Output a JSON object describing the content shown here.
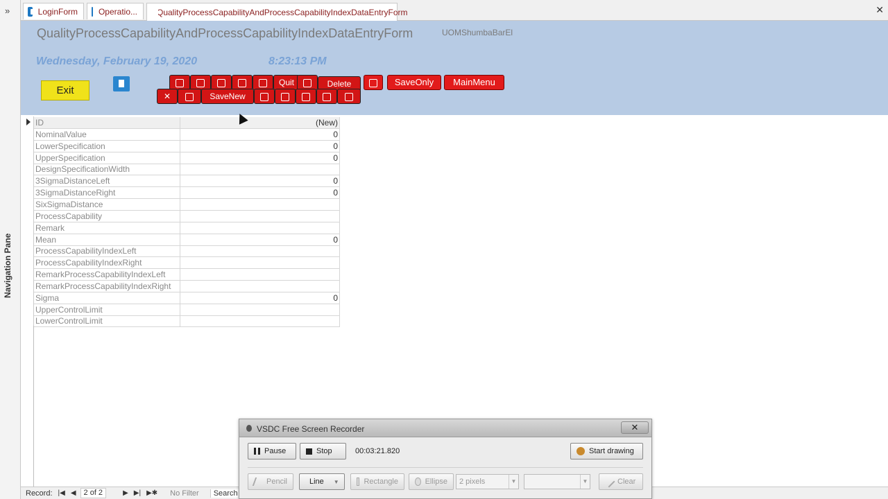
{
  "nav_pane": {
    "label": "Navigation Pane"
  },
  "tabs": [
    {
      "label": "LoginForm"
    },
    {
      "label": "Operatio..."
    },
    {
      "label": "QualityProcessCapabilityAndProcessCapabilityIndexDataEntryForm"
    }
  ],
  "header": {
    "title": "QualityProcessCapabilityAndProcessCapabilityIndexDataEntryForm",
    "user": "UOMShumbaBarEl",
    "date": "Wednesday, February 19, 2020",
    "time": "8:23:13 PM",
    "exit_label": "Exit"
  },
  "toolbar": {
    "quit": "Quit",
    "delete": "Delete",
    "save_new": "SaveNew",
    "save_only": "SaveOnly",
    "main_menu": "MainMenu"
  },
  "fields": [
    {
      "label": "ID",
      "value": "(New)"
    },
    {
      "label": "NominalValue",
      "value": "0"
    },
    {
      "label": "LowerSpecification",
      "value": "0"
    },
    {
      "label": "UpperSpecification",
      "value": "0"
    },
    {
      "label": "DesignSpecificationWidth",
      "value": ""
    },
    {
      "label": "3SigmaDistanceLeft",
      "value": "0"
    },
    {
      "label": "3SigmaDistanceRight",
      "value": "0"
    },
    {
      "label": "SixSigmaDistance",
      "value": ""
    },
    {
      "label": "ProcessCapability",
      "value": ""
    },
    {
      "label": "Remark",
      "value": ""
    },
    {
      "label": "Mean",
      "value": "0"
    },
    {
      "label": "ProcessCapabilityIndexLeft",
      "value": ""
    },
    {
      "label": "ProcessCapabilityIndexRight",
      "value": ""
    },
    {
      "label": "RemarkProcessCapabilityIndexLeft",
      "value": ""
    },
    {
      "label": "RemarkProcessCapabilityIndexRight",
      "value": ""
    },
    {
      "label": "Sigma",
      "value": "0"
    },
    {
      "label": "UpperControlLimit",
      "value": ""
    },
    {
      "label": "LowerControlLimit",
      "value": ""
    }
  ],
  "statusbar": {
    "record_label": "Record:",
    "position": "2 of 2",
    "filter": "No Filter",
    "search": "Search"
  },
  "recorder": {
    "title": "VSDC Free Screen Recorder",
    "close": "✕",
    "pause": "Pause",
    "stop": "Stop",
    "timer": "00:03:21.820",
    "start_drawing": "Start drawing",
    "pencil": "Pencil",
    "line": "Line",
    "rectangle": "Rectangle",
    "ellipse": "Ellipse",
    "thickness": "2 pixels",
    "clear": "Clear"
  },
  "colors": {
    "header_bg": "#b7cbe4",
    "red_button": "#e21b1b",
    "exit_button": "#f0e21a",
    "date_text": "#7aa3d6",
    "tab_text": "#8a1e1e"
  }
}
